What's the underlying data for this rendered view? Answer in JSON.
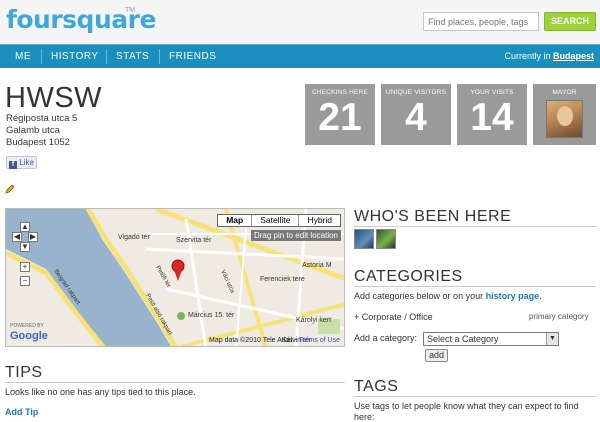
{
  "header": {
    "logo": "foursquare",
    "logo_tm": "TM",
    "search_placeholder": "Find places, people, tags",
    "search_button": "SEARCH"
  },
  "nav": {
    "items": [
      "ME",
      "HISTORY",
      "STATS",
      "FRIENDS"
    ],
    "current_prefix": "Currently in ",
    "current_city": "Budapest"
  },
  "venue": {
    "name": "HWSW",
    "address": [
      "Régiposta utca 5",
      "Galamb utca",
      "Budapest 1052"
    ],
    "like_label": "Like"
  },
  "stats": [
    {
      "label": "CHECKINS HERE",
      "value": "21"
    },
    {
      "label": "UNIQUE VISITORS",
      "value": "4"
    },
    {
      "label": "YOUR VISITS",
      "value": "14"
    },
    {
      "label": "MAYOR",
      "value": ""
    }
  ],
  "map": {
    "buttons": [
      "Map",
      "Satellite",
      "Hybrid"
    ],
    "drag_hint": "Drag pin to edit location",
    "google_powered": "POWERED BY",
    "google": "Google",
    "attribution": "Map data ©2010 Tele Atlas - ",
    "terms": "Terms of Use",
    "labels": [
      "Vigadó tér",
      "Szervita tér",
      "Petőfi tér",
      "Váci utca",
      "Ferenciek tere",
      "Astoria M",
      "Március 15. tér",
      "Károlyi kert",
      "Kálvin tér",
      "Belgrád rakpart",
      "Pesti alsó rakpart"
    ]
  },
  "whos_been_here": {
    "title": "WHO'S BEEN HERE"
  },
  "categories": {
    "title": "CATEGORIES",
    "hint_prefix": "Add categories below or on your ",
    "hint_link": "history page",
    "hint_suffix": ".",
    "category": "+ Corporate / Office",
    "primary": "primary category",
    "add_label": "Add a category:",
    "select_value": "Select a Category",
    "add_button": "add"
  },
  "tips": {
    "title": "TIPS",
    "empty": "Looks like no one has any tips tied to this place.",
    "add_link": "Add Tip"
  },
  "tags": {
    "title": "TAGS",
    "hint": "Use tags to let people know what they can expect to find here:"
  }
}
